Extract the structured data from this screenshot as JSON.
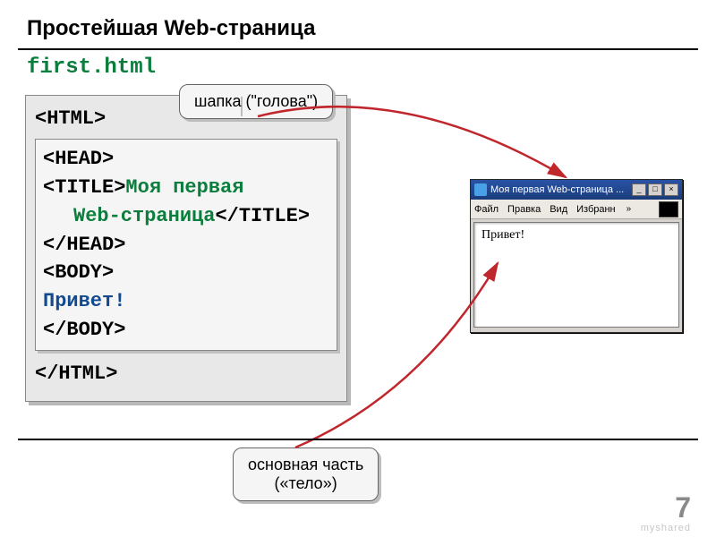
{
  "slide": {
    "title": "Простейшая Web-страница",
    "filename": "first.html",
    "number": "7",
    "watermark": "myshared"
  },
  "code": {
    "html_open": "<HTML>",
    "head_open": "<HEAD>",
    "title_open": "<TITLE>",
    "title_text1": "Моя первая",
    "title_text2": "Web-страница",
    "title_close": "</TITLE>",
    "head_close": "</HEAD>",
    "body_open": "<BODY>",
    "body_text": "Привет!",
    "body_close": "</BODY>",
    "html_close": "</HTML>"
  },
  "callouts": {
    "head": "шапка (\"голова\")",
    "body_line1": "основная часть",
    "body_line2": "(«тело»)"
  },
  "browser": {
    "title": "Моя первая Web-страница ...",
    "menu": {
      "file": "Файл",
      "edit": "Правка",
      "view": "Вид",
      "fav": "Избранн",
      "more": "»"
    },
    "content": "Привет!",
    "btn_min": "_",
    "btn_max": "□",
    "btn_close": "×"
  }
}
